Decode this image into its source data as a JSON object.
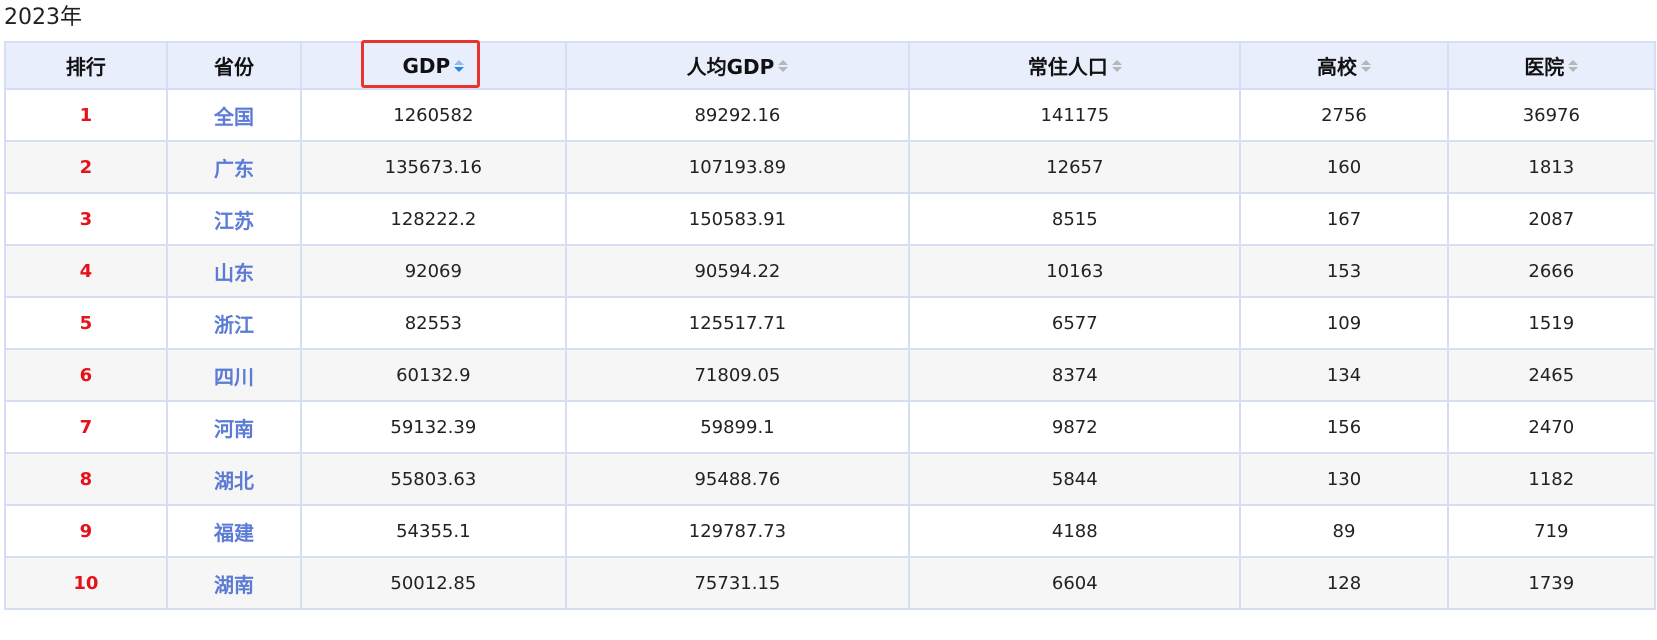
{
  "title": "2023年",
  "table": {
    "headers": [
      {
        "key": "rank",
        "label": "排行",
        "sortable": false
      },
      {
        "key": "province",
        "label": "省份",
        "sortable": false
      },
      {
        "key": "gdp",
        "label": "GDP",
        "sortable": true,
        "active": true
      },
      {
        "key": "gdp_per_capita",
        "label": "人均GDP",
        "sortable": true
      },
      {
        "key": "population",
        "label": "常住人口",
        "sortable": true
      },
      {
        "key": "universities",
        "label": "高校",
        "sortable": true
      },
      {
        "key": "hospitals",
        "label": "医院",
        "sortable": true
      }
    ],
    "rows": [
      {
        "rank": "1",
        "province": "全国",
        "gdp": "1260582",
        "gdp_per_capita": "89292.16",
        "population": "141175",
        "universities": "2756",
        "hospitals": "36976"
      },
      {
        "rank": "2",
        "province": "广东",
        "gdp": "135673.16",
        "gdp_per_capita": "107193.89",
        "population": "12657",
        "universities": "160",
        "hospitals": "1813"
      },
      {
        "rank": "3",
        "province": "江苏",
        "gdp": "128222.2",
        "gdp_per_capita": "150583.91",
        "population": "8515",
        "universities": "167",
        "hospitals": "2087"
      },
      {
        "rank": "4",
        "province": "山东",
        "gdp": "92069",
        "gdp_per_capita": "90594.22",
        "population": "10163",
        "universities": "153",
        "hospitals": "2666"
      },
      {
        "rank": "5",
        "province": "浙江",
        "gdp": "82553",
        "gdp_per_capita": "125517.71",
        "population": "6577",
        "universities": "109",
        "hospitals": "1519"
      },
      {
        "rank": "6",
        "province": "四川",
        "gdp": "60132.9",
        "gdp_per_capita": "71809.05",
        "population": "8374",
        "universities": "134",
        "hospitals": "2465"
      },
      {
        "rank": "7",
        "province": "河南",
        "gdp": "59132.39",
        "gdp_per_capita": "59899.1",
        "population": "9872",
        "universities": "156",
        "hospitals": "2470"
      },
      {
        "rank": "8",
        "province": "湖北",
        "gdp": "55803.63",
        "gdp_per_capita": "95488.76",
        "population": "5844",
        "universities": "130",
        "hospitals": "1182"
      },
      {
        "rank": "9",
        "province": "福建",
        "gdp": "54355.1",
        "gdp_per_capita": "129787.73",
        "population": "4188",
        "universities": "89",
        "hospitals": "719"
      },
      {
        "rank": "10",
        "province": "湖南",
        "gdp": "50012.85",
        "gdp_per_capita": "75731.15",
        "population": "6604",
        "universities": "128",
        "hospitals": "1739"
      }
    ]
  },
  "colors": {
    "rank": "#e5121b",
    "province": "#5b7bd5",
    "header_bg": "#e8eefb",
    "highlight": "#e8332e",
    "sort_active": "#1e88e5"
  },
  "icons": {
    "sort": "sort-arrows-icon"
  }
}
